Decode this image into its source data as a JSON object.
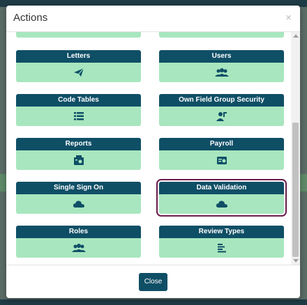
{
  "modal": {
    "title": "Actions",
    "close_symbol": "×",
    "footer_close_label": "Close"
  },
  "tiles": [
    {
      "label": "Letters",
      "icon": "paper-plane-icon"
    },
    {
      "label": "Users",
      "icon": "users-icon"
    },
    {
      "label": "Code Tables",
      "icon": "list-icon"
    },
    {
      "label": "Own Field Group Security",
      "icon": "user-lock-icon"
    },
    {
      "label": "Reports",
      "icon": "report-icon"
    },
    {
      "label": "Payroll",
      "icon": "payroll-icon"
    },
    {
      "label": "Single Sign On",
      "icon": "cloud-icon"
    },
    {
      "label": "Data Validation",
      "icon": "cloud-icon",
      "selected": true
    },
    {
      "label": "Roles",
      "icon": "users-icon"
    },
    {
      "label": "Review Types",
      "icon": "align-left-icon"
    }
  ],
  "colors": {
    "tile_header": "#0f4f66",
    "tile_body": "#a8e6bf",
    "selected_outline": "#6b1b4b"
  }
}
